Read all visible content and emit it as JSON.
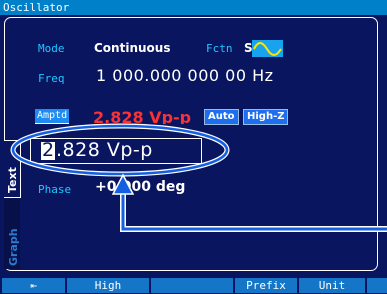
{
  "window": {
    "title": "Oscillator"
  },
  "mode": {
    "label": "Mode",
    "value": "Continuous"
  },
  "function": {
    "label": "Fctn",
    "value": "Sine",
    "icon": "sine-wave-icon"
  },
  "frequency": {
    "label": "Freq",
    "value": "1 000.000 000 00 Hz"
  },
  "amplitude": {
    "label": "Amptd",
    "current_value": "2.828 Vp-p",
    "tags": [
      "Auto",
      "High-Z"
    ],
    "entry_cursor_digit": "2",
    "entry_rest": ".828 Vp-p"
  },
  "phase": {
    "label": "Phase",
    "value": "+0.000 deg"
  },
  "side_tabs": [
    "Text",
    "Graph"
  ],
  "softkeys": [
    "⇤",
    "High",
    "",
    "Prefix",
    "Unit",
    ""
  ],
  "colors": {
    "background": "#0a1560",
    "title_bar": "#0080c8",
    "label": "#1ec8ff",
    "current_value": "#ff3030",
    "softkey": "#1576c8",
    "annotation": "#1560e0"
  }
}
